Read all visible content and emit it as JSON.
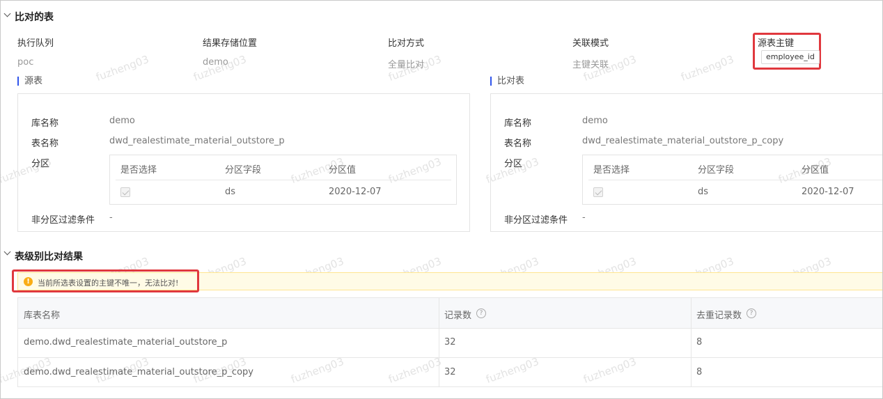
{
  "sections": {
    "compare_tables_title": "比对的表",
    "table_level_result_title": "表级别比对结果"
  },
  "info": {
    "fields": [
      {
        "label": "执行队列",
        "value": "poc"
      },
      {
        "label": "结果存储位置",
        "value": "demo"
      },
      {
        "label": "比对方式",
        "value": "全量比对"
      },
      {
        "label": "关联模式",
        "value": "主键关联"
      }
    ],
    "source_pk_label": "源表主键",
    "source_pk_value": "employee_id"
  },
  "source": {
    "title": "源表",
    "db_label": "库名称",
    "db_value": "demo",
    "table_label": "表名称",
    "table_value": "dwd_realestimate_material_outstore_p",
    "partition_label": "分区",
    "partition_table": {
      "headers": [
        "是否选择",
        "分区字段",
        "分区值"
      ],
      "row": {
        "field": "ds",
        "value": "2020-12-07"
      }
    },
    "filter_label": "非分区过滤条件",
    "filter_value": "-"
  },
  "target": {
    "title": "比对表",
    "db_label": "库名称",
    "db_value": "demo",
    "table_label": "表名称",
    "table_value": "dwd_realestimate_material_outstore_p_copy",
    "partition_label": "分区",
    "partition_table": {
      "headers": [
        "是否选择",
        "分区字段",
        "分区值"
      ],
      "row": {
        "field": "ds",
        "value": "2020-12-07"
      }
    },
    "filter_label": "非分区过滤条件",
    "filter_value": "-"
  },
  "warning": {
    "icon": "!",
    "text": "当前所选表设置的主键不唯一，无法比对!"
  },
  "result_table": {
    "headers": [
      "库表名称",
      "记录数",
      "去重记录数"
    ],
    "help_icon": "?",
    "rows": [
      [
        "demo.dwd_realestimate_material_outstore_p",
        "32",
        "8"
      ],
      [
        "demo.dwd_realestimate_material_outstore_p_copy",
        "32",
        "8"
      ]
    ]
  },
  "watermark": "fuzheng03",
  "colors": {
    "accent": "#2f54eb",
    "highlight_red": "#e0383e",
    "warning_bg": "#fffbe6",
    "warning_border": "#ffe58f",
    "warning_icon": "#faad14"
  }
}
